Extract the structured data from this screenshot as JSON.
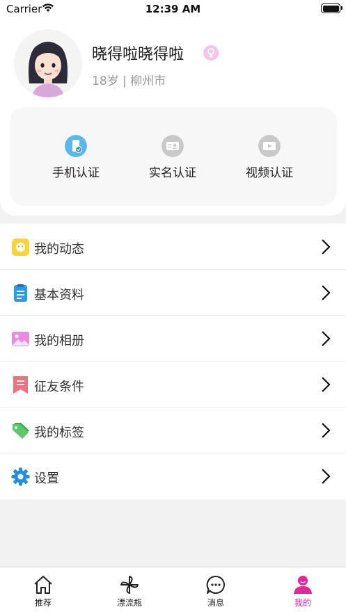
{
  "status_bar": {
    "carrier": "Carrier",
    "time": "12:39 AM"
  },
  "profile": {
    "nickname": "晓得啦晓得啦",
    "sub_info": "18岁 | 柳州市",
    "gender_symbol": "♀"
  },
  "verify": {
    "items": [
      {
        "label": "手机认证",
        "icon": "phone-verify-icon",
        "color": "#5ab8ee"
      },
      {
        "label": "实名认证",
        "icon": "id-card-icon",
        "color": "#c9c9c9"
      },
      {
        "label": "视频认证",
        "icon": "video-icon",
        "color": "#c9c9c9"
      }
    ]
  },
  "menu": {
    "items": [
      {
        "label": "我的动态",
        "icon": "moments-icon"
      },
      {
        "label": "基本资料",
        "icon": "clipboard-icon"
      },
      {
        "label": "我的相册",
        "icon": "album-icon"
      },
      {
        "label": "征友条件",
        "icon": "bookmark-icon"
      },
      {
        "label": "我的标签",
        "icon": "tag-icon"
      },
      {
        "label": "设置",
        "icon": "settings-gear-icon"
      }
    ]
  },
  "tabbar": {
    "tabs": [
      {
        "label": "推荐",
        "icon": "home-icon",
        "active": false
      },
      {
        "label": "漂流瓶",
        "icon": "pinwheel-icon",
        "active": false
      },
      {
        "label": "消息",
        "icon": "message-icon",
        "active": false
      },
      {
        "label": "我的",
        "icon": "profile-icon",
        "active": true
      }
    ]
  },
  "colors": {
    "accent": "#e6259a",
    "verified": "#5ab8ee",
    "unverified": "#c9c9c9"
  }
}
